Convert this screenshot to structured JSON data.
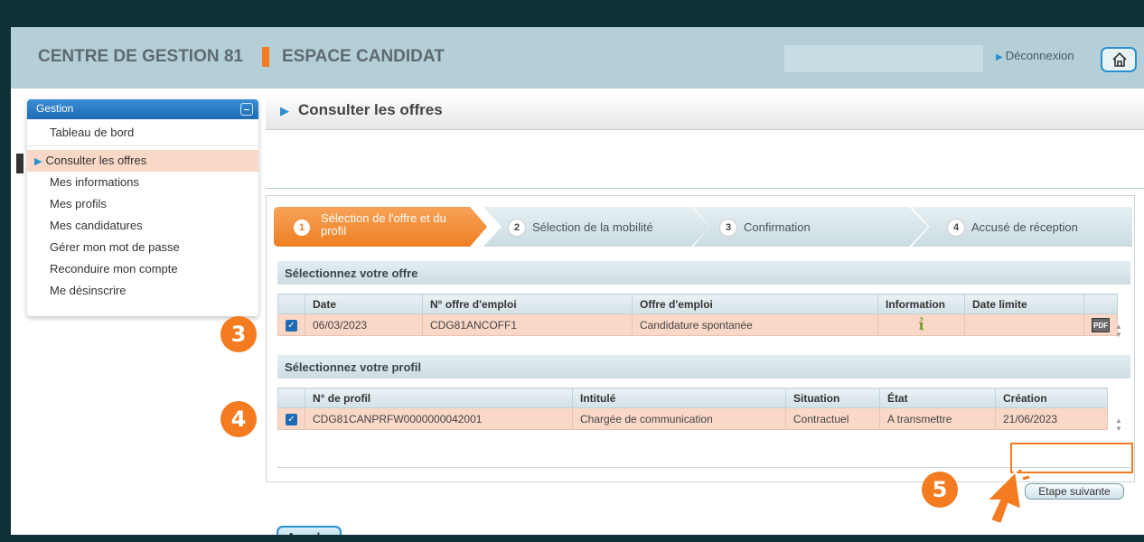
{
  "header": {
    "org_name": "CENTRE DE GESTION 81",
    "space_name": "ESPACE CANDIDAT",
    "logout_label": "Déconnexion",
    "home_icon": "home-icon"
  },
  "sidebar": {
    "section_label": "Gestion",
    "items": [
      {
        "label": "Tableau de bord"
      },
      {
        "label": "Consulter les offres"
      },
      {
        "label": "Mes informations"
      },
      {
        "label": "Mes profils"
      },
      {
        "label": "Mes candidatures"
      },
      {
        "label": "Gérer mon mot de passe"
      },
      {
        "label": "Reconduire mon compte"
      },
      {
        "label": "Me désinscrire"
      }
    ]
  },
  "page": {
    "title": "Consulter les offres"
  },
  "steps": [
    {
      "number": "1",
      "label": "Sélection de l'offre et du profil"
    },
    {
      "number": "2",
      "label": "Sélection de la mobilité"
    },
    {
      "number": "3",
      "label": "Confirmation"
    },
    {
      "number": "4",
      "label": "Accusé de réception"
    }
  ],
  "offer_section": {
    "title": "Sélectionnez votre offre",
    "columns": [
      "Date",
      "N° offre d'emploi",
      "Offre d'emploi",
      "Information",
      "Date limite"
    ],
    "row": {
      "date": "06/03/2023",
      "offer_number": "CDG81ANCOFF1",
      "offer": "Candidature spontanée",
      "info_icon": "info-icon",
      "deadline": "",
      "pdf_label": "PDF"
    }
  },
  "profile_section": {
    "title": "Sélectionnez votre profil",
    "columns": [
      "N° de profil",
      "Intitulé",
      "Situation",
      "État",
      "Création"
    ],
    "row": {
      "profile_number": "CDG81CANPRFW0000000042001",
      "title": "Chargée de communication",
      "situation": "Contractuel",
      "state": "A transmettre",
      "created": "21/06/2023"
    }
  },
  "buttons": {
    "next": "Etape suivante",
    "cancel": "Annuler"
  },
  "annotations": {
    "badge3": "3",
    "badge4": "4",
    "badge5": "5"
  },
  "colors": {
    "accent": "#f47b20",
    "selected_row": "#f9d8c8",
    "header_bg": "#b5cfd8",
    "link_blue": "#2a8fd0"
  }
}
